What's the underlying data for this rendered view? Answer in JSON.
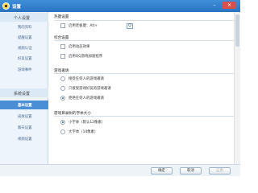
{
  "window": {
    "title": "设置",
    "minimize_glyph": "–",
    "close_glyph": "✕"
  },
  "sidebar": {
    "groups": [
      {
        "label": "个人设置",
        "items": [
          {
            "label": "我的资料"
          },
          {
            "label": "提醒设置"
          },
          {
            "label": "视频认证"
          },
          {
            "label": "好友设置"
          },
          {
            "label": "游戏事件"
          }
        ]
      },
      {
        "label": "系统设置",
        "items": [
          {
            "label": "基本设置",
            "active": true
          },
          {
            "label": "皮肤设置"
          },
          {
            "label": "聊天设置"
          },
          {
            "label": "视频设置"
          }
        ]
      }
    ]
  },
  "content": {
    "hotkey": {
      "title": "热键设置",
      "option": {
        "label": "启用老板键：Alt+",
        "checked": false
      },
      "key_value": "Q"
    },
    "general": {
      "title": "综合设置",
      "options": [
        {
          "label": "启用动态效果",
          "checked": false
        },
        {
          "label": "启用QQ游戏加速程序",
          "checked": false
        }
      ]
    },
    "invite": {
      "title": "游戏邀请",
      "options": [
        {
          "label": "接受任何人的游戏邀请",
          "selected": false
        },
        {
          "label": "只接受游戏好友的游戏邀请",
          "selected": false
        },
        {
          "label": "拒绝任何人的游戏邀请",
          "selected": true
        }
      ]
    },
    "font": {
      "title": "游戏目录树的字体大小",
      "options": [
        {
          "label": "小字体（默认12像素）",
          "selected": true
        },
        {
          "label": "大字体（14像素）",
          "selected": false
        }
      ]
    }
  },
  "footer": {
    "ok": "确定",
    "cancel": "取消",
    "apply": "应用"
  },
  "colors": {
    "titlebar": "#2a73c2",
    "active_item": "#4a8fd6",
    "close_button": "#d9504a"
  }
}
